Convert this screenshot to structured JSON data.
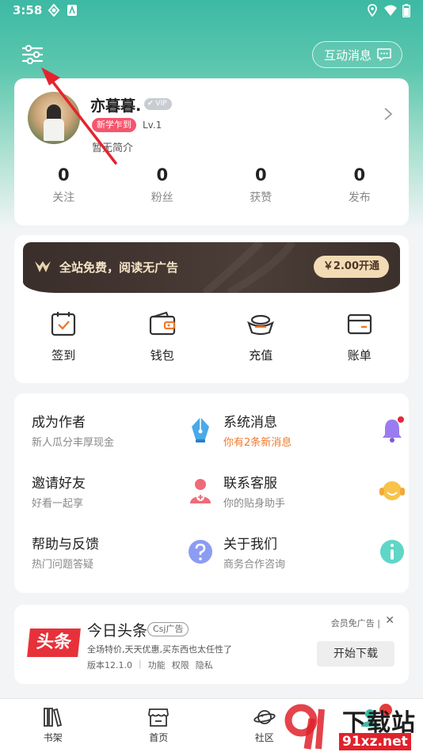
{
  "status_bar": {
    "time": "3:58"
  },
  "header": {
    "message_button_label": "互动消息"
  },
  "profile": {
    "username": "亦暮暮.",
    "vip_label": "VIP",
    "new_badge": "新学乍到",
    "level": "Lv.1",
    "intro": "暂无简介",
    "stats": [
      {
        "value": "0",
        "label": "关注"
      },
      {
        "value": "0",
        "label": "粉丝"
      },
      {
        "value": "0",
        "label": "获赞"
      },
      {
        "value": "0",
        "label": "发布"
      }
    ]
  },
  "vip_banner": {
    "text": "全站免费，阅读无广告",
    "button": "￥2.00开通"
  },
  "quick_actions": [
    {
      "label": "签到",
      "icon": "calendar-check-icon"
    },
    {
      "label": "钱包",
      "icon": "wallet-icon"
    },
    {
      "label": "充值",
      "icon": "gold-ingot-icon"
    },
    {
      "label": "账单",
      "icon": "card-icon"
    }
  ],
  "menu": [
    {
      "title": "成为作者",
      "subtitle": "新人瓜分丰厚现金",
      "icon": "pen-icon"
    },
    {
      "title": "系统消息",
      "subtitle": "你有2条新消息",
      "icon": "bell-icon"
    },
    {
      "title": "邀请好友",
      "subtitle": "好看一起享",
      "icon": "add-person-icon"
    },
    {
      "title": "联系客服",
      "subtitle": "你的贴身助手",
      "icon": "headset-icon"
    },
    {
      "title": "帮助与反馈",
      "subtitle": "热门问题答疑",
      "icon": "question-icon"
    },
    {
      "title": "关于我们",
      "subtitle": "商务合作咨询",
      "icon": "info-icon"
    }
  ],
  "ad": {
    "logo_text": "头条",
    "title": "今日头条",
    "tag": "Csj广告",
    "description": "全场特价,天天优惠,买东西也太任性了",
    "version": "版本12.1.0",
    "links": [
      "功能",
      "权限",
      "隐私"
    ],
    "free_label": "会员免广告",
    "close": "✕",
    "download": "开始下载"
  },
  "bottom_nav": [
    {
      "label": "书架",
      "icon": "bookshelf-icon"
    },
    {
      "label": "首页",
      "icon": "store-icon"
    },
    {
      "label": "社区",
      "icon": "planet-icon"
    },
    {
      "label": "",
      "icon": "profile-icon"
    }
  ],
  "watermark": {
    "text1": "下载站",
    "text2": "91xz.net"
  },
  "colors": {
    "accent_teal": "#3db9a4",
    "badge_red": "#f5556d",
    "vip_gold": "#f2dbb5",
    "message_orange": "#f07a2b"
  }
}
